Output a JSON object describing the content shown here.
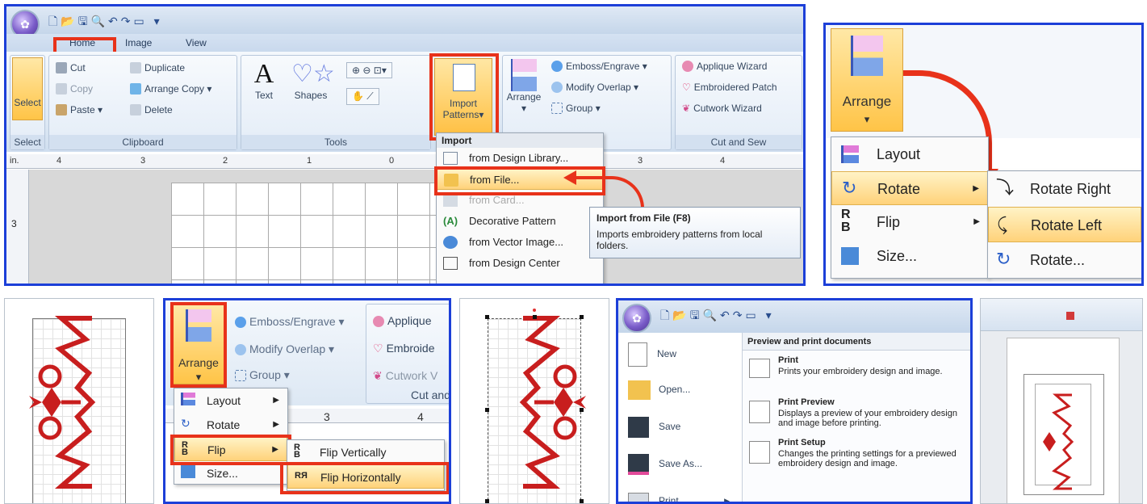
{
  "panel1": {
    "tabs": [
      "Home",
      "Image",
      "View"
    ],
    "select_group": {
      "button": "Select",
      "label": "Select"
    },
    "clipboard": {
      "label": "Clipboard",
      "cut": "Cut",
      "copy": "Copy",
      "paste": "Paste",
      "duplicate": "Duplicate",
      "arrange_copy": "Arrange Copy",
      "delete": "Delete"
    },
    "tools": {
      "label": "Tools",
      "text": "Text",
      "shapes": "Shapes"
    },
    "import_button": {
      "line1": "Import",
      "line2": "Patterns"
    },
    "arrange_button": "Arrange",
    "arrange_group": {
      "emboss": "Emboss/Engrave",
      "modify": "Modify Overlap",
      "group": "Group"
    },
    "cut_and_sew": {
      "label": "Cut and Sew",
      "applique": "Applique Wizard",
      "patch": "Embroidered Patch",
      "cutwork": "Cutwork Wizard"
    },
    "ruler_unit": "in.",
    "ruler_ticks": [
      "4",
      "3",
      "2",
      "1",
      "0",
      "3",
      "4"
    ],
    "ruler_side": "3",
    "import_menu": {
      "header": "Import",
      "items": [
        "from Design Library...",
        "from File...",
        "from Card...",
        "Decorative Pattern",
        "from Vector Image...",
        "from Design Center"
      ]
    },
    "tooltip": {
      "title": "Import from File (F8)",
      "body": "Imports embroidery patterns from local folders."
    }
  },
  "panel2": {
    "arrange": "Arrange",
    "menu": [
      "Layout",
      "Rotate",
      "Flip",
      "Size..."
    ],
    "submenu": [
      "Rotate Right",
      "Rotate Left",
      "Rotate..."
    ]
  },
  "panel4": {
    "arrange": "Arrange",
    "emboss": "Emboss/Engrave",
    "modify": "Modify Overlap",
    "group": "Group",
    "applique": "Applique",
    "embroidered": "Embroide",
    "cutwork": "Cutwork V",
    "cut_and": "Cut and",
    "menu": [
      "Layout",
      "Rotate",
      "Flip",
      "Size..."
    ],
    "submenu": [
      "Flip Vertically",
      "Flip Horizontally"
    ],
    "ruler_ticks": [
      "3",
      "4"
    ]
  },
  "panel6": {
    "left_items": [
      "New",
      "Open...",
      "Save",
      "Save As...",
      "Print"
    ],
    "header": "Preview and print documents",
    "entries": [
      {
        "title": "Print",
        "desc": "Prints your embroidery design and image."
      },
      {
        "title": "Print Preview",
        "desc": "Displays a preview of your embroidery design and image before printing."
      },
      {
        "title": "Print Setup",
        "desc": "Changes the printing settings for a previewed embroidery design and image."
      }
    ]
  },
  "colors": {
    "frame_blue": "#1c3fd8",
    "highlight_red": "#e8321a",
    "design_red": "#c81e1e"
  }
}
